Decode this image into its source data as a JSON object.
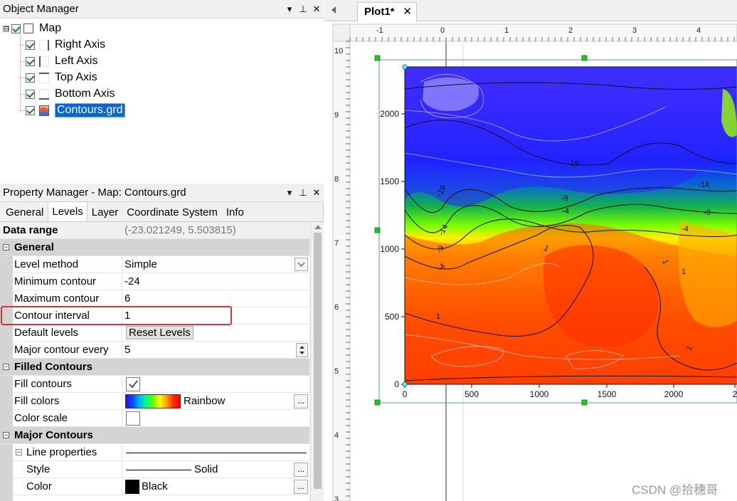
{
  "object_manager": {
    "title": "Object Manager",
    "pane_buttons": [
      "▾",
      "⊥",
      "✕"
    ],
    "tree": {
      "root": {
        "label": "Map",
        "checked": true,
        "expander": "⊟"
      },
      "children": [
        {
          "label": "Right Axis",
          "checked": true,
          "icon": "right-axis-icon"
        },
        {
          "label": "Left Axis",
          "checked": true,
          "icon": "left-axis-icon"
        },
        {
          "label": "Top Axis",
          "checked": true,
          "icon": "top-axis-icon"
        },
        {
          "label": "Bottom Axis",
          "checked": true,
          "icon": "bottom-axis-icon"
        },
        {
          "label": "Contours.grd",
          "checked": true,
          "icon": "contour-layer-icon",
          "selected": true
        }
      ]
    }
  },
  "property_manager": {
    "title": "Property Manager - Map: Contours.grd",
    "tabs": [
      "General",
      "Levels",
      "Layer",
      "Coordinate System",
      "Info"
    ],
    "active_tab": "Levels",
    "data_range": {
      "label": "Data range",
      "value": "(-23.021249, 5.503815)"
    },
    "sections": {
      "general": "General",
      "filled": "Filled Contours",
      "major": "Major Contours"
    },
    "props": {
      "level_method": {
        "label": "Level method",
        "value": "Simple"
      },
      "min_contour": {
        "label": "Minimum contour",
        "value": "-24"
      },
      "max_contour": {
        "label": "Maximum contour",
        "value": "6"
      },
      "contour_interval": {
        "label": "Contour interval",
        "value": "1"
      },
      "default_levels": {
        "label": "Default levels",
        "button": "Reset Levels"
      },
      "major_every": {
        "label": "Major contour every",
        "value": "5"
      },
      "fill_contours": {
        "label": "Fill contours",
        "checked": true
      },
      "fill_colors": {
        "label": "Fill colors",
        "value": "Rainbow"
      },
      "color_scale": {
        "label": "Color scale",
        "checked": false
      },
      "line_properties": {
        "label": "Line properties",
        "expander": "⊟"
      },
      "style": {
        "label": "Style",
        "value": "Solid"
      },
      "color": {
        "label": "Color",
        "value": "Black",
        "swatch": "#000000"
      }
    },
    "ellipsis": "..."
  },
  "document": {
    "tab_label": "Plot1*",
    "close": "✕"
  },
  "plot": {
    "ruler_top_labels": [
      "-1",
      "0",
      "1",
      "2",
      "3",
      "4"
    ],
    "ruler_left_labels": [
      "10",
      "9",
      "8",
      "7",
      "6",
      "5",
      "4",
      "3"
    ],
    "y_ticks": [
      "2000",
      "1500",
      "1000",
      "500",
      "0"
    ],
    "x_ticks": [
      "0",
      "500",
      "1000",
      "1500",
      "2000",
      "2"
    ],
    "contour_labels": [
      "-19",
      "-19",
      "-14",
      "-14",
      "-9",
      "-9",
      "-9",
      "-4",
      "-4",
      "-4",
      "1",
      "1",
      "1",
      "1",
      "1"
    ]
  },
  "colors": {
    "selection_blue": "#0a64d6",
    "highlight_red": "#e53030",
    "section_gray": "#d4d4d4"
  },
  "watermark": "CSDN @拾穗哥"
}
